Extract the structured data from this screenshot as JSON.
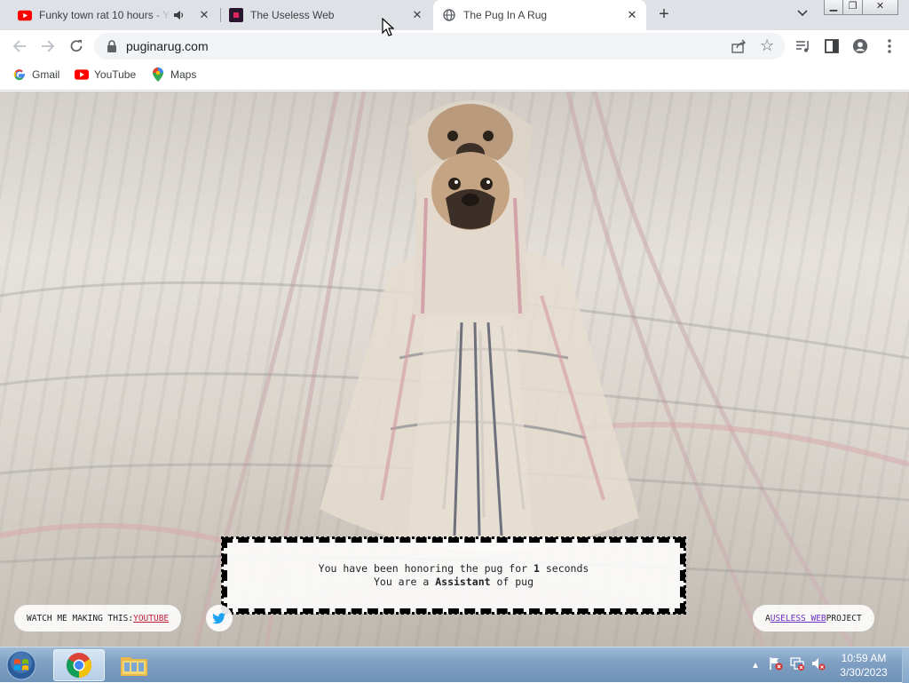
{
  "tabs": [
    {
      "title": "Funky town rat 10 hours - YouTube",
      "audio_icon": "speaker-icon",
      "favicon": "youtube-icon"
    },
    {
      "title": "The Useless Web",
      "favicon": "useless-web-icon"
    },
    {
      "title": "The Pug In A Rug",
      "favicon": "globe-icon",
      "active": true
    }
  ],
  "toolbar": {
    "url": "puginarug.com"
  },
  "bookmarks": [
    {
      "label": "Gmail",
      "icon": "google-icon"
    },
    {
      "label": "YouTube",
      "icon": "youtube-icon"
    },
    {
      "label": "Maps",
      "icon": "maps-icon"
    }
  ],
  "page": {
    "message_prefix_1": "You have been honoring the pug for ",
    "seconds": "1",
    "message_suffix_1": " seconds",
    "message_prefix_2": "You are a ",
    "rank": "Assistant",
    "message_suffix_2": " of pug",
    "watch_label": "WATCH ME MAKING THIS: ",
    "watch_link": "YOUTUBE",
    "project_prefix": "A ",
    "project_link": "USELESS WEB",
    "project_suffix": " PROJECT"
  },
  "taskbar": {
    "time": "10:59 AM",
    "date": "3/30/2023"
  },
  "colors": {
    "tabstrip": "#dee1e6",
    "youtube_red": "#ff0000",
    "link_red": "#c21e3a",
    "link_purple": "#6b2fc2"
  }
}
